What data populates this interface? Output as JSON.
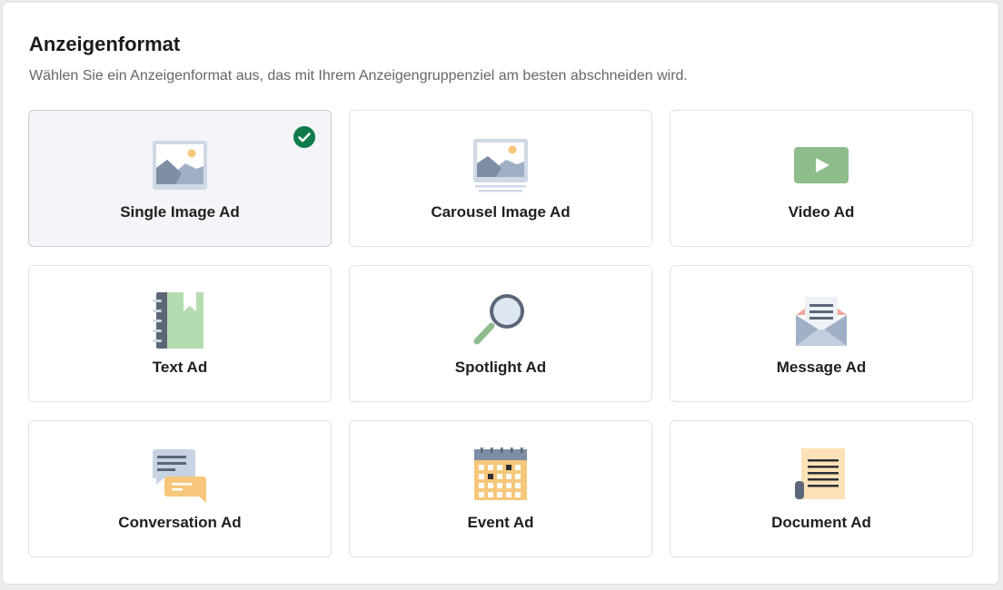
{
  "header": {
    "title": "Anzeigenformat",
    "subtitle": "Wählen Sie ein Anzeigenformat aus, das mit Ihrem Anzeigengruppenziel am besten abschneiden wird."
  },
  "formats": [
    {
      "label": "Single Image Ad",
      "icon": "image-icon",
      "selected": true
    },
    {
      "label": "Carousel Image Ad",
      "icon": "carousel-image-icon",
      "selected": false
    },
    {
      "label": "Video Ad",
      "icon": "video-play-icon",
      "selected": false
    },
    {
      "label": "Text Ad",
      "icon": "notebook-icon",
      "selected": false
    },
    {
      "label": "Spotlight Ad",
      "icon": "magnifier-icon",
      "selected": false
    },
    {
      "label": "Message Ad",
      "icon": "envelope-letter-icon",
      "selected": false
    },
    {
      "label": "Conversation Ad",
      "icon": "chat-bubbles-icon",
      "selected": false
    },
    {
      "label": "Event Ad",
      "icon": "calendar-icon",
      "selected": false
    },
    {
      "label": "Document Ad",
      "icon": "document-scroll-icon",
      "selected": false
    }
  ],
  "colors": {
    "selected_check": "#0f7b4b",
    "selected_bg": "#f3f5f8",
    "icon_slate": "#7d8ea5",
    "icon_green": "#8fbc8b",
    "icon_orange": "#f6c77a"
  }
}
